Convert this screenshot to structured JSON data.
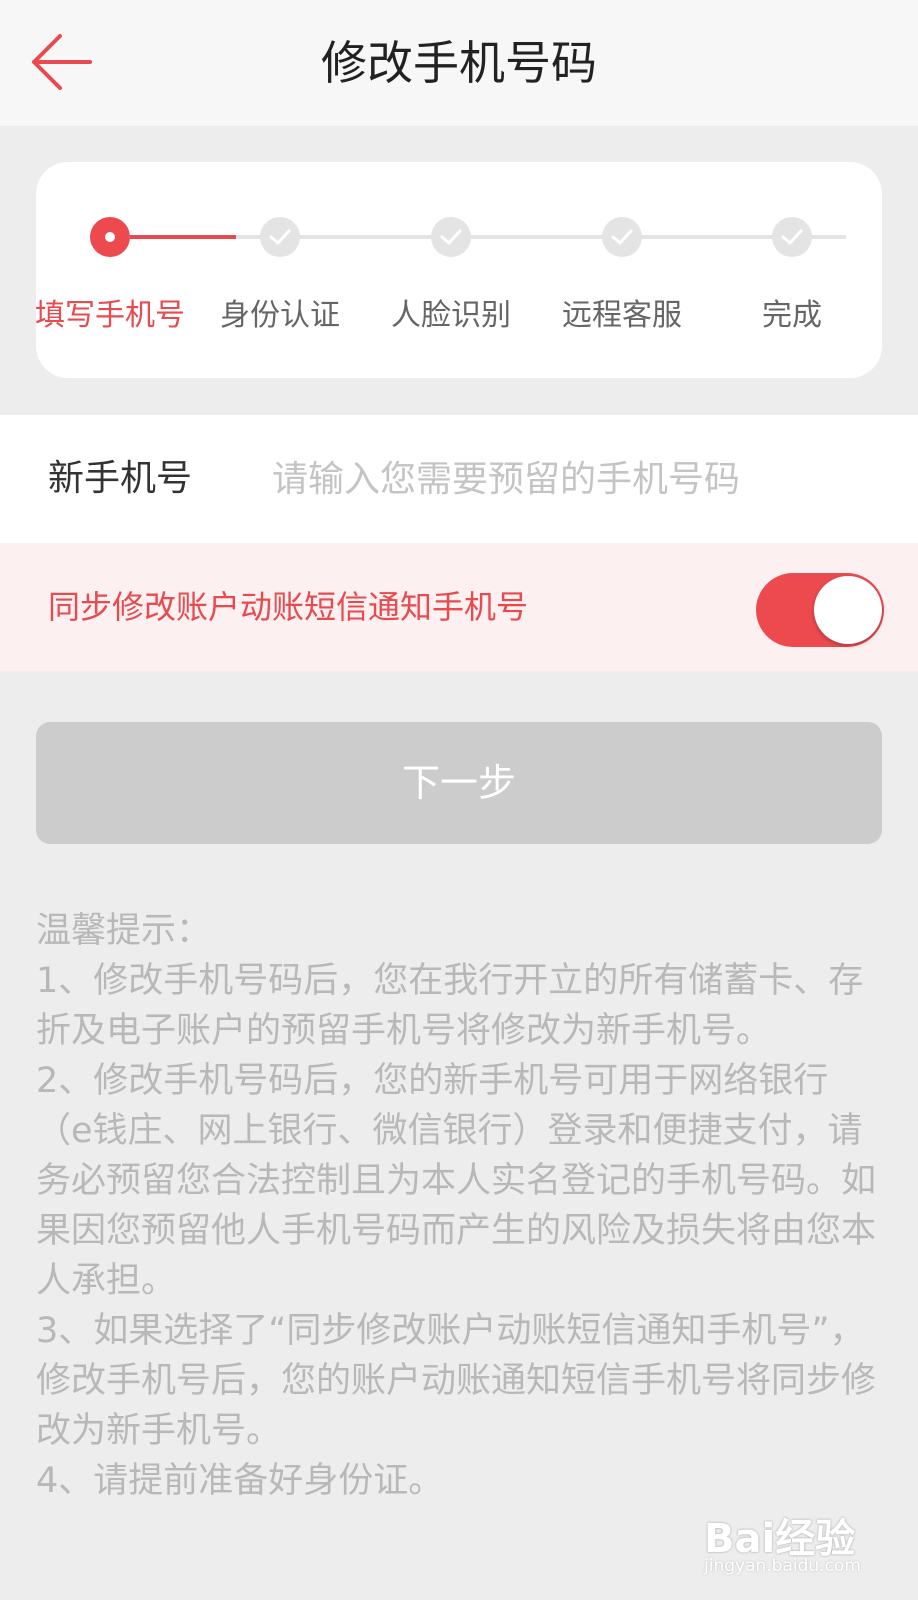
{
  "header": {
    "title": "修改手机号码"
  },
  "steps": [
    {
      "label": "填写手机号",
      "status": "current"
    },
    {
      "label": "身份认证",
      "status": "pending"
    },
    {
      "label": "人脸识别",
      "status": "pending"
    },
    {
      "label": "远程客服",
      "status": "pending"
    },
    {
      "label": "完成",
      "status": "pending"
    }
  ],
  "phone": {
    "label": "新手机号",
    "value": "",
    "placeholder": "请输入您需要预留的手机号码"
  },
  "sync": {
    "label": "同步修改账户动账短信通知手机号",
    "enabled": true
  },
  "next_button": {
    "label": "下一步",
    "enabled": false
  },
  "tips": {
    "title": "温馨提示：",
    "items": [
      "1、修改手机号码后，您在我行开立的所有储蓄卡、存折及电子账户的预留手机号将修改为新手机号。",
      "2、修改手机号码后，您的新手机号可用于网络银行（e钱庄、网上银行、微信银行）登录和便捷支付，请务必预留您合法控制且为本人实名登记的手机号码。如果因您预留他人手机号码而产生的风险及损失将由您本人承担。",
      "3、如果选择了“同步修改账户动账短信通知手机号”，修改手机号后，您的账户动账通知短信手机号将同步修改为新手机号。",
      "4、请提前准备好身份证。"
    ]
  },
  "colors": {
    "accent": "#e84a4f",
    "background": "#ededed",
    "disabled_button": "#cccccc"
  },
  "watermark": {
    "brand": "Bai经验",
    "url": "jingyan.baidu.com"
  }
}
